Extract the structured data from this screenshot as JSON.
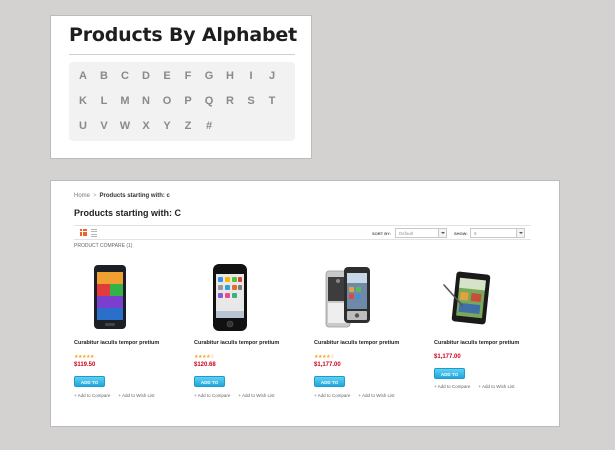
{
  "alphabet_widget": {
    "title": "Products By Alphabet",
    "rows": [
      [
        "A",
        "B",
        "C",
        "D",
        "E",
        "F",
        "G",
        "H",
        "I",
        "J"
      ],
      [
        "K",
        "L",
        "M",
        "N",
        "O",
        "P",
        "Q",
        "R",
        "S",
        "T"
      ],
      [
        "U",
        "V",
        "W",
        "X",
        "Y",
        "Z",
        "#"
      ]
    ]
  },
  "category_page": {
    "breadcrumb": {
      "home": "Home",
      "separator": ">",
      "current": "Products starting with: c"
    },
    "title": "Products starting with: C",
    "toolbar": {
      "sort_label": "SORT BY:",
      "sort_value": "Default",
      "show_label": "SHOW:",
      "show_value": "8"
    },
    "compare_label": "PRODUCT COMPARE (1)",
    "products": [
      {
        "name": "Curabitur iaculis tempor pretium",
        "stars": "★★★★★",
        "price": "$119.50",
        "cart": "ADD TO CART",
        "compare": "+ Add to Compare",
        "wishlist": "+ Add to Wish List"
      },
      {
        "name": "Curabitur iaculis tempor pretium",
        "stars": "★★★★☆",
        "price": "$120.68",
        "cart": "ADD TO CART",
        "compare": "+ Add to Compare",
        "wishlist": "+ Add to Wish List"
      },
      {
        "name": "Curabitur iaculis tempor pretium",
        "stars": "★★★★☆",
        "price": "$1,177.00",
        "cart": "ADD TO CART",
        "compare": "+ Add to Compare",
        "wishlist": "+ Add to Wish List"
      },
      {
        "name": "Curabitur iaculis tempor pretium",
        "stars": "",
        "price": "$1,177.00",
        "cart": "ADD TO CART",
        "compare": "+ Add to Compare",
        "wishlist": "+ Add to Wish List"
      }
    ]
  }
}
